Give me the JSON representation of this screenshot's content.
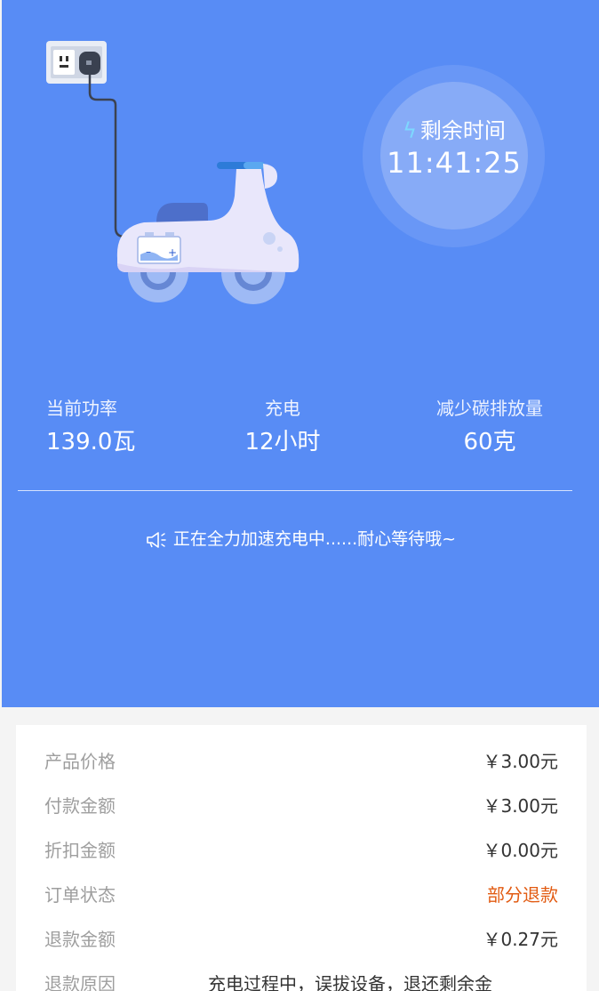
{
  "timer": {
    "label": "剩余时间",
    "value": "11:41:25"
  },
  "stats": [
    {
      "label": "当前功率",
      "value": "139.0瓦"
    },
    {
      "label": "充电",
      "value": "12小时"
    },
    {
      "label": "减少碳排放量",
      "value": "60克"
    }
  ],
  "notice": "正在全力加速充电中......耐心等待哦~",
  "order": {
    "rows": [
      {
        "key": "产品价格",
        "value": "￥3.00元"
      },
      {
        "key": "付款金额",
        "value": "￥3.00元"
      },
      {
        "key": "折扣金额",
        "value": "￥0.00元"
      },
      {
        "key": "订单状态",
        "value": "部分退款"
      },
      {
        "key": "退款金额",
        "value": "￥0.27元"
      },
      {
        "key": "退款原因",
        "value": "充电过程中，误拔设备，退还剩余金"
      }
    ]
  },
  "colors": {
    "hero": "#588cf5",
    "status_refund": "#e25b12"
  }
}
